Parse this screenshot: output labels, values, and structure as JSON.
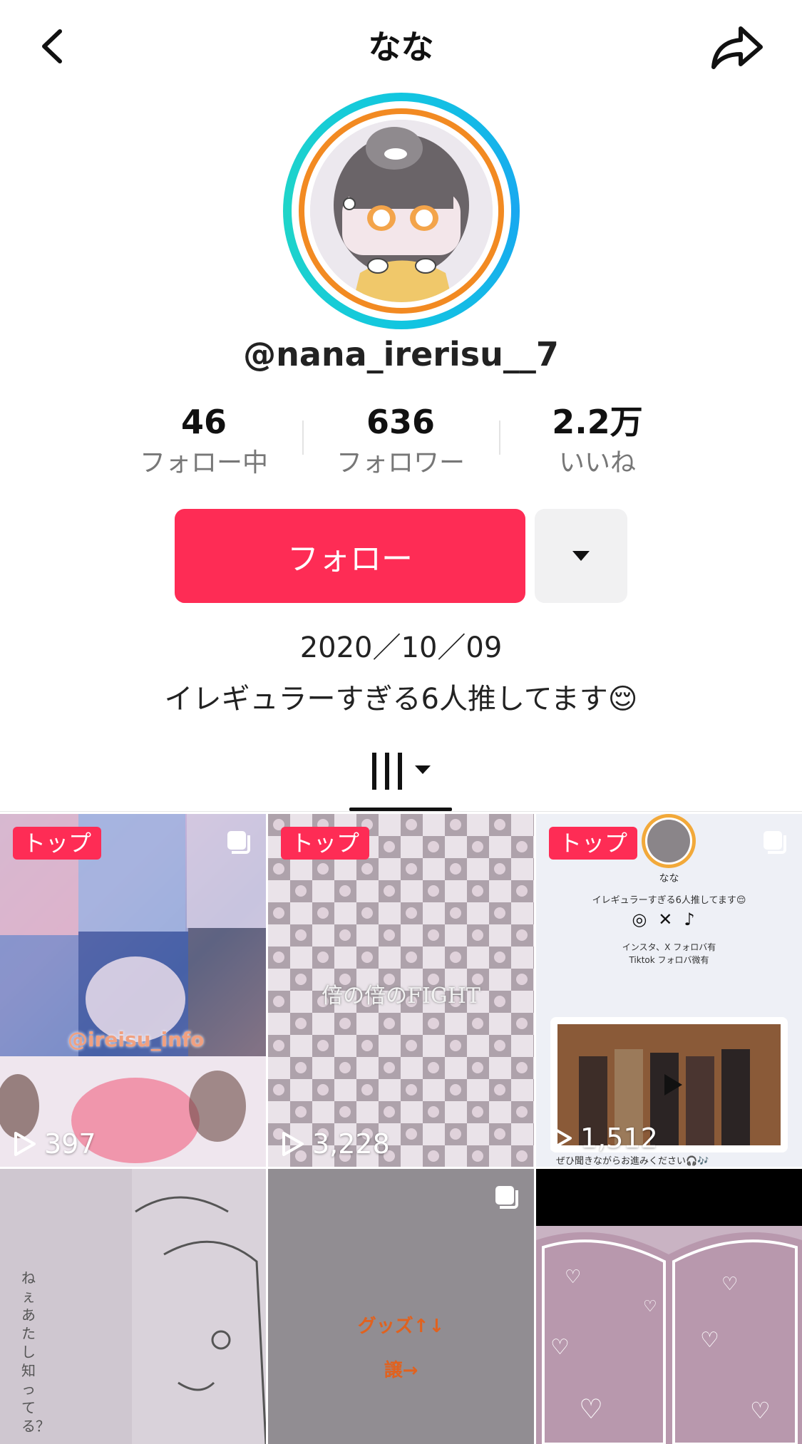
{
  "header": {
    "title": "なな"
  },
  "profile": {
    "handle": "@nana_irerisu__7",
    "stats": [
      {
        "value": "46",
        "label": "フォロー中"
      },
      {
        "value": "636",
        "label": "フォロワー"
      },
      {
        "value": "2.2万",
        "label": "いいね"
      }
    ],
    "follow_label": "フォロー",
    "bio_line1": "2020／10／09",
    "bio_line2": "イレギュラーすぎる6人推してます😌"
  },
  "videos": [
    {
      "badge": "トップ",
      "views": "397",
      "caption": "@ireisu_info"
    },
    {
      "badge": "トップ",
      "views": "3,228",
      "caption": "倍の倍のFIGHT"
    },
    {
      "badge": "トップ",
      "views": "1,512",
      "card_name": "なな",
      "card_line1": "イレギュラーすぎる6人推してます😌",
      "card_line2": "インスタ、X フォロバ有",
      "card_line3": "Tiktok フォロバ微有",
      "card_footer": "ぜひ聞きながらお進みください🎧🎶"
    },
    {
      "text": "ねぇあたし知ってる？"
    },
    {
      "text1": "グッズ↑↓",
      "text2": "譲→"
    },
    {}
  ],
  "colors": {
    "accent": "#fe2c55",
    "ring": "#12c6e0",
    "ring_inner": "#f28a22"
  }
}
